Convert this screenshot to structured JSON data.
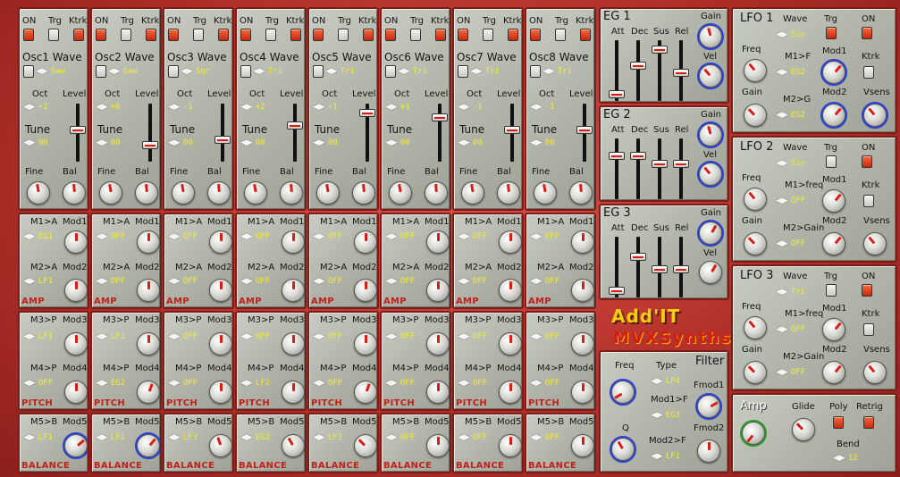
{
  "osc_header": {
    "on": "ON",
    "trg": "Trg",
    "ktrk": "Ktrk",
    "oct": "Oct",
    "level": "Level",
    "tune": "Tune",
    "fine": "Fine",
    "bal": "Bal"
  },
  "oscillators": [
    {
      "wave_label": "Osc1 Wave",
      "wave": "Saw",
      "oct": "+2",
      "tune": "00",
      "on": true,
      "trg": false,
      "ktrk": true,
      "level": 0.55
    },
    {
      "wave_label": "Osc2 Wave",
      "wave": "Saw",
      "oct": "+0",
      "tune": "00",
      "on": true,
      "trg": false,
      "ktrk": true,
      "level": 0.25
    },
    {
      "wave_label": "Osc3 Wave",
      "wave": "Sqr",
      "oct": "-1",
      "tune": "00",
      "on": true,
      "trg": false,
      "ktrk": true,
      "level": 0.35
    },
    {
      "wave_label": "Osc4 Wave",
      "wave": "Tri",
      "oct": "+2",
      "tune": "00",
      "on": true,
      "trg": false,
      "ktrk": true,
      "level": 0.65
    },
    {
      "wave_label": "Osc5 Wave",
      "wave": "Tri",
      "oct": "+1",
      "tune": "00",
      "on": true,
      "trg": false,
      "ktrk": true,
      "level": 0.9
    },
    {
      "wave_label": "Osc6 Wave",
      "wave": "Tri",
      "oct": "+1",
      "tune": "00",
      "on": true,
      "trg": false,
      "ktrk": true,
      "level": 0.8
    },
    {
      "wave_label": "Osc7 Wave",
      "wave": "Tri",
      "oct": "-1",
      "tune": "00",
      "on": true,
      "trg": false,
      "ktrk": true,
      "level": 0.55
    },
    {
      "wave_label": "Osc8 Wave",
      "wave": "Tri",
      "oct": "-1",
      "tune": "00",
      "on": true,
      "trg": false,
      "ktrk": true,
      "level": 0.55
    }
  ],
  "amp_rows": [
    {
      "m1": "M1>A",
      "mod1": "Mod1",
      "m1v": "EG1",
      "m2": "M2>A",
      "mod2": "Mod2",
      "m2v": "LF1"
    },
    {
      "m1": "M1>A",
      "mod1": "Mod1",
      "m1v": "OFF",
      "m2": "M2>A",
      "mod2": "Mod2",
      "m2v": "OFF"
    },
    {
      "m1": "M1>A",
      "mod1": "Mod1",
      "m1v": "OFF",
      "m2": "M2>A",
      "mod2": "Mod2",
      "m2v": "OFF"
    },
    {
      "m1": "M1>A",
      "mod1": "Mod1",
      "m1v": "OFF",
      "m2": "M2>A",
      "mod2": "Mod2",
      "m2v": "OFF"
    },
    {
      "m1": "M1>A",
      "mod1": "Mod1",
      "m1v": "OFF",
      "m2": "M2>A",
      "mod2": "Mod2",
      "m2v": "OFF"
    },
    {
      "m1": "M1>A",
      "mod1": "Mod1",
      "m1v": "OFF",
      "m2": "M2>A",
      "mod2": "Mod2",
      "m2v": "OFF"
    },
    {
      "m1": "M1>A",
      "mod1": "Mod1",
      "m1v": "OFF",
      "m2": "M2>A",
      "mod2": "Mod2",
      "m2v": "OFF"
    },
    {
      "m1": "M1>A",
      "mod1": "Mod1",
      "m1v": "OFF",
      "m2": "M2>A",
      "mod2": "Mod2",
      "m2v": "OFF"
    }
  ],
  "pitch_rows": [
    {
      "m3": "M3>P",
      "mod3": "Mod3",
      "m3v": "LF1",
      "m4": "M4>P",
      "mod4": "Mod4",
      "m4v": "OFF"
    },
    {
      "m3": "M3>P",
      "mod3": "Mod3",
      "m3v": "LF1",
      "m4": "M4>P",
      "mod4": "Mod4",
      "m4v": "EG2"
    },
    {
      "m3": "M3>P",
      "mod3": "Mod3",
      "m3v": "OFF",
      "m4": "M4>P",
      "mod4": "Mod4",
      "m4v": "OFF"
    },
    {
      "m3": "M3>P",
      "mod3": "Mod3",
      "m3v": "OFF",
      "m4": "M4>P",
      "mod4": "Mod4",
      "m4v": "LF2"
    },
    {
      "m3": "M3>P",
      "mod3": "Mod3",
      "m3v": "OFF",
      "m4": "M4>P",
      "mod4": "Mod4",
      "m4v": "OFF"
    },
    {
      "m3": "M3>P",
      "mod3": "Mod3",
      "m3v": "OFF",
      "m4": "M4>P",
      "mod4": "Mod4",
      "m4v": "OFF"
    },
    {
      "m3": "M3>P",
      "mod3": "Mod3",
      "m3v": "OFF",
      "m4": "M4>P",
      "mod4": "Mod4",
      "m4v": "OFF"
    },
    {
      "m3": "M3>P",
      "mod3": "Mod3",
      "m3v": "OFF",
      "m4": "M4>P",
      "mod4": "Mod4",
      "m4v": "OFF"
    }
  ],
  "balance_rows": [
    {
      "m5": "M5>B",
      "mod5": "Mod5",
      "m5v": "LF1"
    },
    {
      "m5": "M5>B",
      "mod5": "Mod5",
      "m5v": "LF1"
    },
    {
      "m5": "M5>B",
      "mod5": "Mod5",
      "m5v": "LF3"
    },
    {
      "m5": "M5>B",
      "mod5": "Mod5",
      "m5v": "EG2"
    },
    {
      "m5": "M5>B",
      "mod5": "Mod5",
      "m5v": "LF3"
    },
    {
      "m5": "M5>B",
      "mod5": "Mod5",
      "m5v": "OFF"
    },
    {
      "m5": "M5>B",
      "mod5": "Mod5",
      "m5v": "OFF"
    },
    {
      "m5": "M5>B",
      "mod5": "Mod5",
      "m5v": "OFF"
    }
  ],
  "sections": {
    "amp": "AMP",
    "pitch": "PITCH",
    "balance": "BALANCE"
  },
  "eg": [
    {
      "title": "EG 1",
      "att": "Att",
      "dec": "Dec",
      "sus": "Sus",
      "rel": "Rel",
      "gain": "Gain",
      "vel": "Vel",
      "levels": [
        0.05,
        0.6,
        0.9,
        0.45
      ]
    },
    {
      "title": "EG 2",
      "att": "Att",
      "dec": "Dec",
      "sus": "Sus",
      "rel": "Rel",
      "gain": "Gain",
      "vel": "Vel",
      "levels": [
        0.75,
        0.75,
        0.6,
        0.6
      ]
    },
    {
      "title": "EG 3",
      "att": "Att",
      "dec": "Dec",
      "sus": "Sus",
      "rel": "Rel",
      "gain": "Gain",
      "vel": "Vel",
      "levels": [
        0.05,
        0.7,
        0.45,
        0.45
      ]
    }
  ],
  "lfo": [
    {
      "title": "LFO 1",
      "wave_lbl": "Wave",
      "wave": "Sin",
      "trg": "Trg",
      "on": "ON",
      "freq": "Freq",
      "mod1": "Mod1",
      "m1": "M1>F",
      "m1v": "EG2",
      "ktrk": "Ktrk",
      "gain": "Gain",
      "m2": "M2>G",
      "m2v": "EG2",
      "mod2": "Mod2",
      "vsens": "Vsens",
      "trg_on": true,
      "on_on": true,
      "ktrk_on": false
    },
    {
      "title": "LFO 2",
      "wave_lbl": "Wave",
      "wave": "Sin",
      "trg": "Trg",
      "on": "ON",
      "freq": "Freq",
      "mod1": "Mod1",
      "m1": "M1>freq",
      "m1v": "OFF",
      "ktrk": "Ktrk",
      "gain": "Gain",
      "m2": "M2>Gain",
      "m2v": "OFF",
      "mod2": "Mod2",
      "vsens": "Vsens",
      "trg_on": false,
      "on_on": true,
      "ktrk_on": false
    },
    {
      "title": "LFO 3",
      "wave_lbl": "Wave",
      "wave": "Tri",
      "trg": "Trg",
      "on": "ON",
      "freq": "Freq",
      "mod1": "Mod1",
      "m1": "M1>freq",
      "m1v": "OFF",
      "ktrk": "Ktrk",
      "gain": "Gain",
      "m2": "M2>Gain",
      "m2v": "OFF",
      "mod2": "Mod2",
      "vsens": "Vsens",
      "trg_on": false,
      "on_on": true,
      "ktrk_on": false
    }
  ],
  "logo": {
    "line1": "Add'IT",
    "line2": "MVXSynths"
  },
  "filter": {
    "title": "Filter",
    "freq": "Freq",
    "type": "Type",
    "type_v": "LP4",
    "mod1f": "Mod1>F",
    "mod1f_v": "EG3",
    "fmod1": "Fmod1",
    "q": "Q",
    "mod2f": "Mod2>F",
    "mod2f_v": "LF1",
    "fmod2": "Fmod2"
  },
  "amp": {
    "title": "Amp",
    "glide": "Glide",
    "poly": "Poly",
    "retrig": "Retrig",
    "bend": "Bend",
    "bend_v": "12"
  }
}
